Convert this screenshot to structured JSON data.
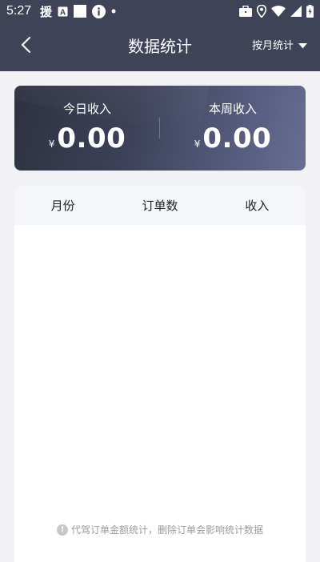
{
  "status_bar": {
    "time": "5:27",
    "left_icons": [
      "app-notification-icon",
      "font-icon",
      "square-icon",
      "info-icon",
      "dot-icon"
    ],
    "right_icons": [
      "briefcase-icon",
      "location-icon",
      "wifi-icon",
      "signal-icon",
      "battery-icon"
    ]
  },
  "header": {
    "title": "数据统计",
    "filter_label": "按月统计",
    "back_icon": "chevron-left-icon",
    "filter_icon": "caret-down-icon"
  },
  "summary": {
    "today": {
      "label": "今日收入",
      "currency": "¥",
      "value": "0.00"
    },
    "week": {
      "label": "本周收入",
      "currency": "¥",
      "value": "0.00"
    }
  },
  "table": {
    "columns": [
      "月份",
      "订单数",
      "收入"
    ],
    "rows": []
  },
  "note": {
    "icon": "info-circle-icon",
    "text": "代驾订单金额统计，删除订单会影响统计数据"
  },
  "colors": {
    "header_bg": "#3f4358",
    "card_gradient_start": "#2d3140",
    "card_gradient_end": "#686e93",
    "page_bg": "#f2f2f4"
  }
}
